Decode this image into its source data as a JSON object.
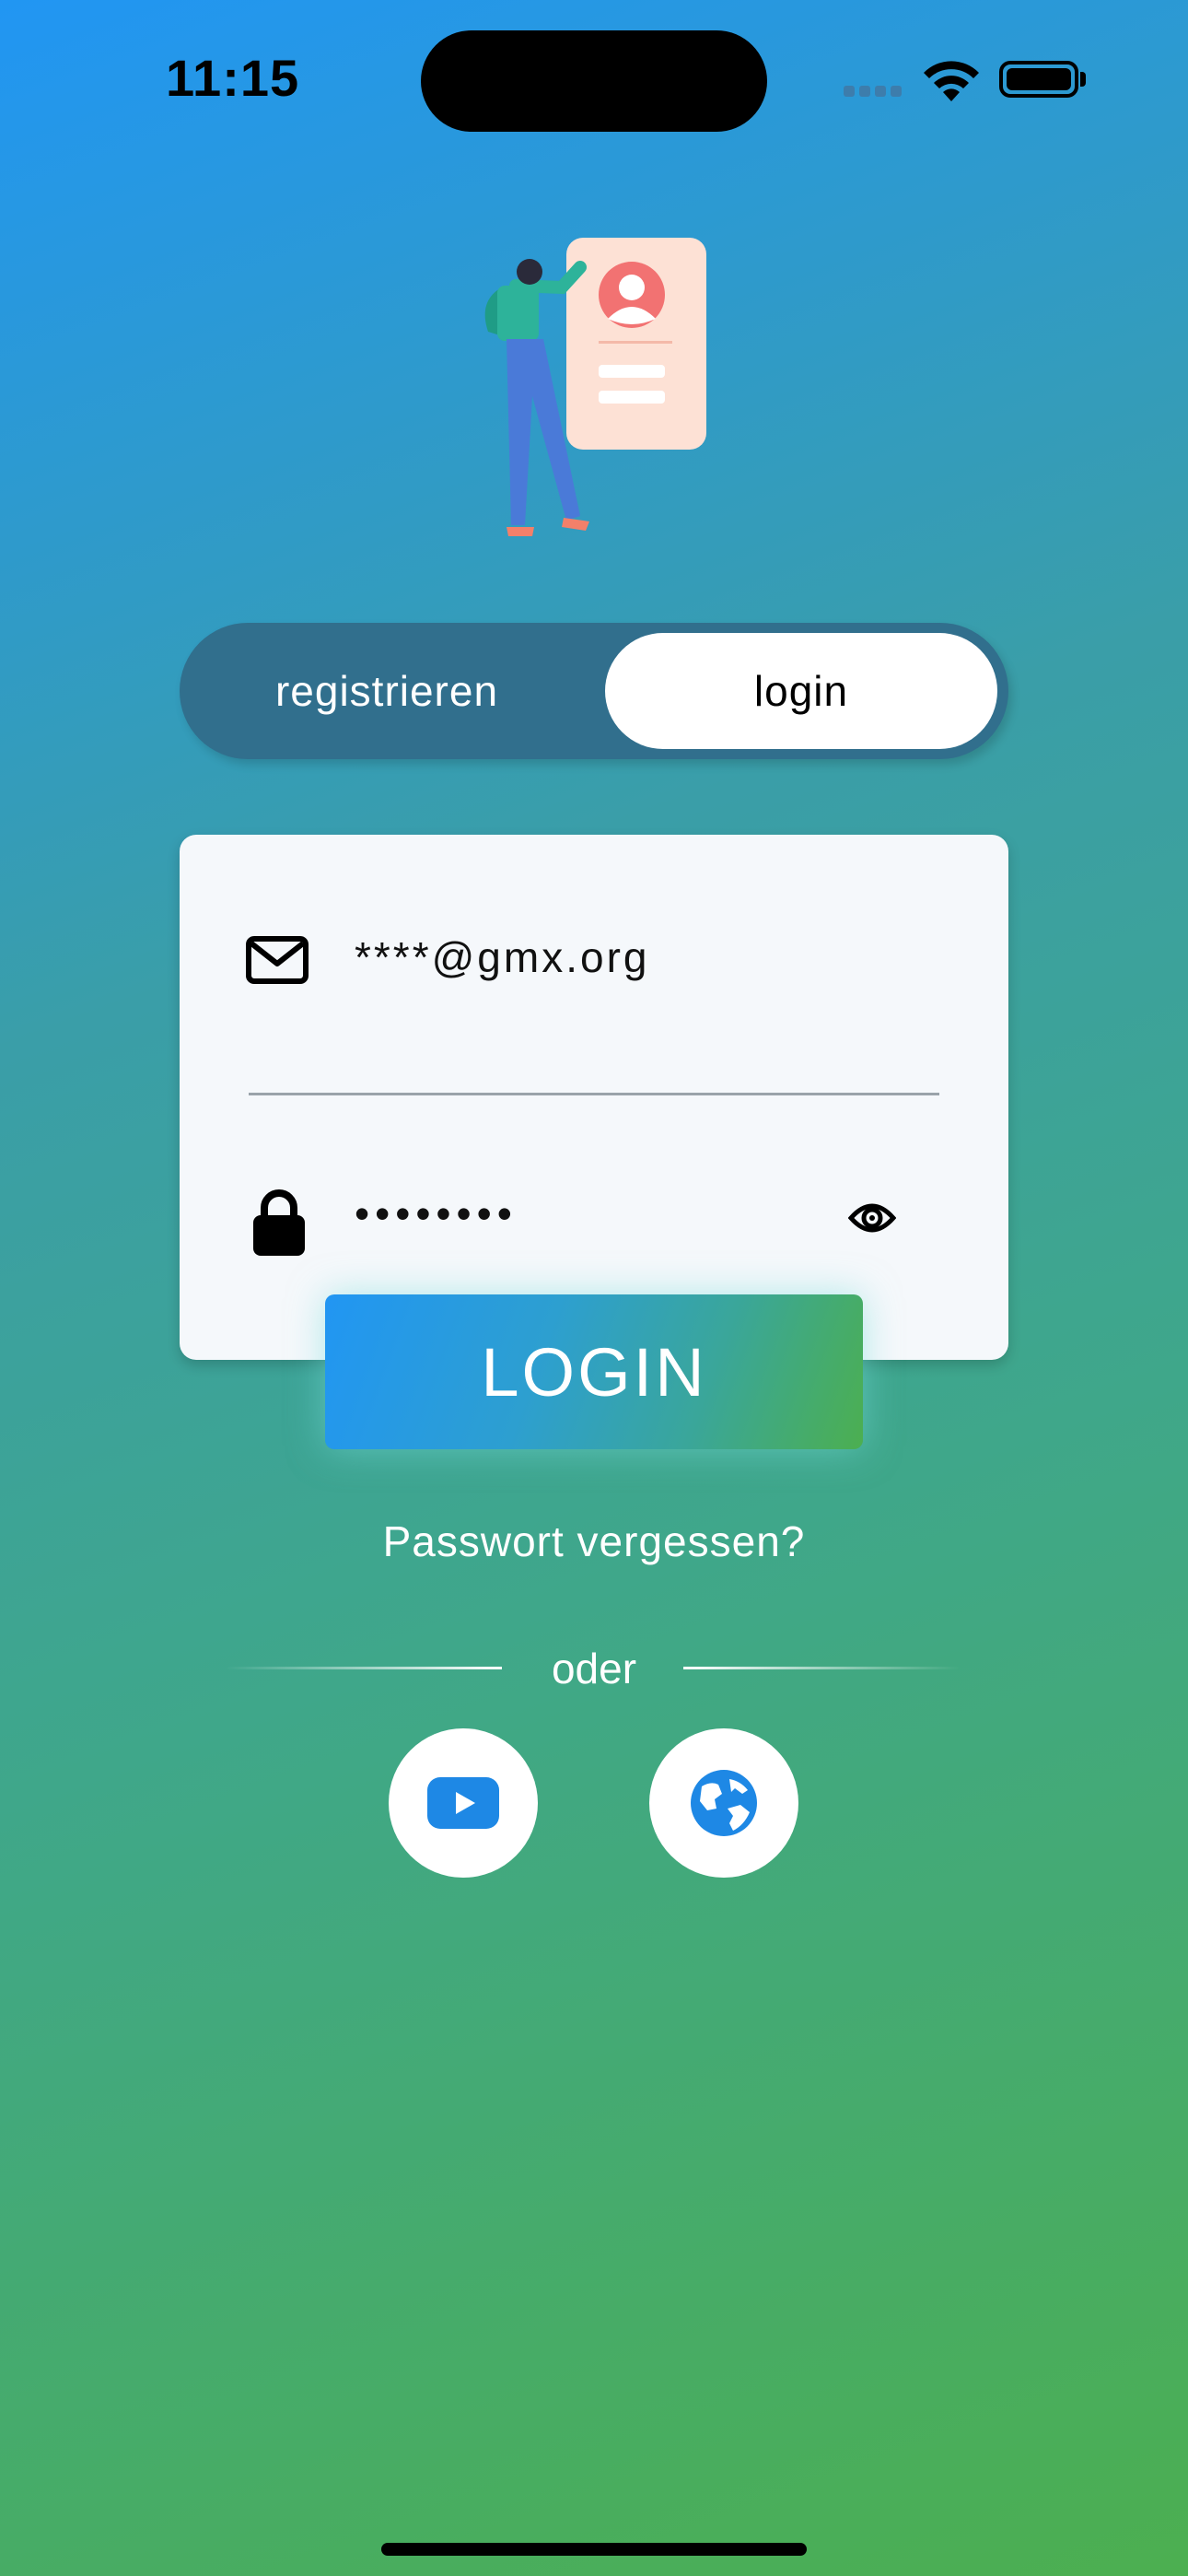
{
  "status_bar": {
    "time": "11:15"
  },
  "auth_toggle": {
    "register_label": "registrieren",
    "login_label": "login",
    "selected": "login"
  },
  "form": {
    "email_value": "****@gmx.org",
    "password_value": "••••••••"
  },
  "login_button": {
    "label": "LOGIN"
  },
  "forgot_password": {
    "label": "Passwort vergessen?"
  },
  "separator": {
    "label": "oder"
  },
  "social": [
    {
      "icon": "youtube-icon",
      "color": "#1E88E5"
    },
    {
      "icon": "globe-icon",
      "color": "#1E88E5"
    }
  ],
  "colors": {
    "gradient_start": "#2196F3",
    "gradient_end": "#4CAF50",
    "toggle_bg": "#316f8d",
    "accent_blue": "#1E88E5"
  }
}
